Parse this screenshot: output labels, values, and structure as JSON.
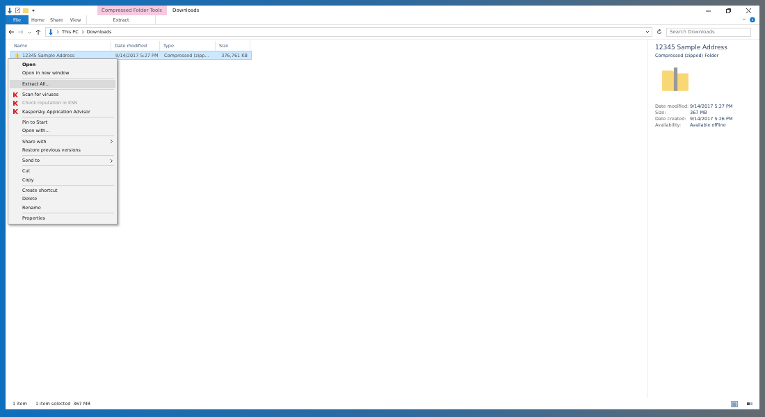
{
  "title_bar": {
    "contextual_group": "Compressed Folder Tools",
    "title": "Downloads"
  },
  "ribbon_tabs": [
    {
      "label": "File",
      "kind": "file"
    },
    {
      "label": "Home",
      "kind": "tab"
    },
    {
      "label": "Share",
      "kind": "tab"
    },
    {
      "label": "View",
      "kind": "tab"
    },
    {
      "label": "Extract",
      "kind": "contextual"
    }
  ],
  "address_bar": {
    "crumbs": [
      "This PC",
      "Downloads"
    ]
  },
  "search": {
    "placeholder": "Search Downloads"
  },
  "columns": [
    "Name",
    "Date modified",
    "Type",
    "Size"
  ],
  "rows": [
    {
      "cells": [
        "12345 Sample Address",
        "9/14/2017 5:27 PM",
        "Compressed (zipp...",
        "376,761 KB"
      ],
      "selected": true
    }
  ],
  "context_menu": [
    {
      "kind": "item",
      "label": "Open",
      "default": true,
      "selected": false,
      "disabled": false,
      "submenu": false
    },
    {
      "kind": "item",
      "label": "Open in new window",
      "default": false,
      "selected": false,
      "disabled": false,
      "submenu": false
    },
    {
      "kind": "separator"
    },
    {
      "kind": "item",
      "label": "Extract All...",
      "default": false,
      "selected": true,
      "disabled": false,
      "submenu": false
    },
    {
      "kind": "separator"
    },
    {
      "kind": "antivirus_item",
      "label": "Scan for viruses",
      "default": false,
      "selected": false,
      "disabled": false,
      "submenu": false
    },
    {
      "kind": "antivirus_item",
      "label": "Check reputation in KSN",
      "default": false,
      "selected": false,
      "disabled": true,
      "submenu": false
    },
    {
      "kind": "antivirus_item",
      "label": "Kaspersky Application Advisor",
      "default": false,
      "selected": false,
      "disabled": false,
      "submenu": false
    },
    {
      "kind": "separator"
    },
    {
      "kind": "item",
      "label": "Pin to Start",
      "default": false,
      "selected": false,
      "disabled": false,
      "submenu": false
    },
    {
      "kind": "item",
      "label": "Open with...",
      "default": false,
      "selected": false,
      "disabled": false,
      "submenu": false
    },
    {
      "kind": "separator"
    },
    {
      "kind": "item",
      "label": "Share with",
      "default": false,
      "selected": false,
      "disabled": false,
      "submenu": true
    },
    {
      "kind": "item",
      "label": "Restore previous versions",
      "default": false,
      "selected": false,
      "disabled": false,
      "submenu": false
    },
    {
      "kind": "separator"
    },
    {
      "kind": "item",
      "label": "Send to",
      "default": false,
      "selected": false,
      "disabled": false,
      "submenu": true
    },
    {
      "kind": "separator"
    },
    {
      "kind": "item",
      "label": "Cut",
      "default": false,
      "selected": false,
      "disabled": false,
      "submenu": false
    },
    {
      "kind": "item",
      "label": "Copy",
      "default": false,
      "selected": false,
      "disabled": false,
      "submenu": false
    },
    {
      "kind": "separator"
    },
    {
      "kind": "item",
      "label": "Create shortcut",
      "default": false,
      "selected": false,
      "disabled": false,
      "submenu": false
    },
    {
      "kind": "item",
      "label": "Delete",
      "default": false,
      "selected": false,
      "disabled": false,
      "submenu": false
    },
    {
      "kind": "item",
      "label": "Rename",
      "default": false,
      "selected": false,
      "disabled": false,
      "submenu": false
    },
    {
      "kind": "separator"
    },
    {
      "kind": "item",
      "label": "Properties",
      "default": false,
      "selected": false,
      "disabled": false,
      "submenu": false
    }
  ],
  "details": {
    "name": "12345 Sample Address",
    "type": "Compressed (zipped) Folder",
    "properties": [
      {
        "label": "Date modified:",
        "value": "9/14/2017 5:27 PM"
      },
      {
        "label": "Size:",
        "value": "367 MB"
      },
      {
        "label": "Date created:",
        "value": "9/14/2017 5:26 PM"
      },
      {
        "label": "Availability:",
        "value": "Available offline"
      }
    ]
  },
  "status_bar": {
    "count": "1 item",
    "selection": "1 item selected",
    "size": "367 MB"
  }
}
